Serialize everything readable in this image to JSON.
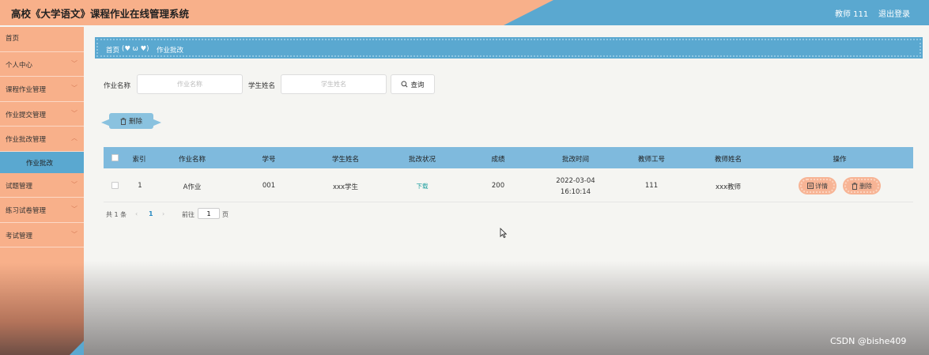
{
  "header": {
    "title": "高校《大学语文》课程作业在线管理系统",
    "user": "教师 111",
    "logout": "退出登录"
  },
  "sidebar": {
    "items": [
      {
        "label": "首页",
        "has_children": false
      },
      {
        "label": "个人中心",
        "has_children": true
      },
      {
        "label": "课程作业管理",
        "has_children": true
      },
      {
        "label": "作业提交管理",
        "has_children": true
      },
      {
        "label": "作业批改管理",
        "has_children": true
      },
      {
        "label": "试题管理",
        "has_children": true
      },
      {
        "label": "练习试卷管理",
        "has_children": true
      },
      {
        "label": "考试管理",
        "has_children": true
      }
    ],
    "active_sub": "作业批改"
  },
  "breadcrumb": {
    "home": "首页",
    "separator": "(♥ ω ♥)",
    "current": "作业批改"
  },
  "search": {
    "field1_label": "作业名称",
    "field1_placeholder": "作业名称",
    "field2_label": "学生姓名",
    "field2_placeholder": "学生姓名",
    "button": "查询"
  },
  "actions": {
    "delete": "删除"
  },
  "table": {
    "headers": [
      "索引",
      "作业名称",
      "学号",
      "学生姓名",
      "批改状况",
      "成绩",
      "批改时间",
      "教师工号",
      "教师姓名",
      "操作"
    ],
    "rows": [
      {
        "index": "1",
        "name": "A作业",
        "student_id": "001",
        "student_name": "xxx学生",
        "status": "下载",
        "score": "200",
        "time": "2022-03-04 16:10:14",
        "teacher_id": "111",
        "teacher_name": "xxx教师",
        "detail": "详情",
        "delete": "删除"
      }
    ]
  },
  "pagination": {
    "total": "共 1 条",
    "prev": "‹",
    "current": "1",
    "next": "›",
    "goto_label": "前往",
    "goto_value": "1",
    "page_suffix": "页"
  },
  "watermark": "CSDN @bishe409",
  "colors": {
    "orange": "#f8b08a",
    "blue": "#5aa8d0",
    "table_header": "#7fbadd",
    "op_button": "#f7b495"
  }
}
